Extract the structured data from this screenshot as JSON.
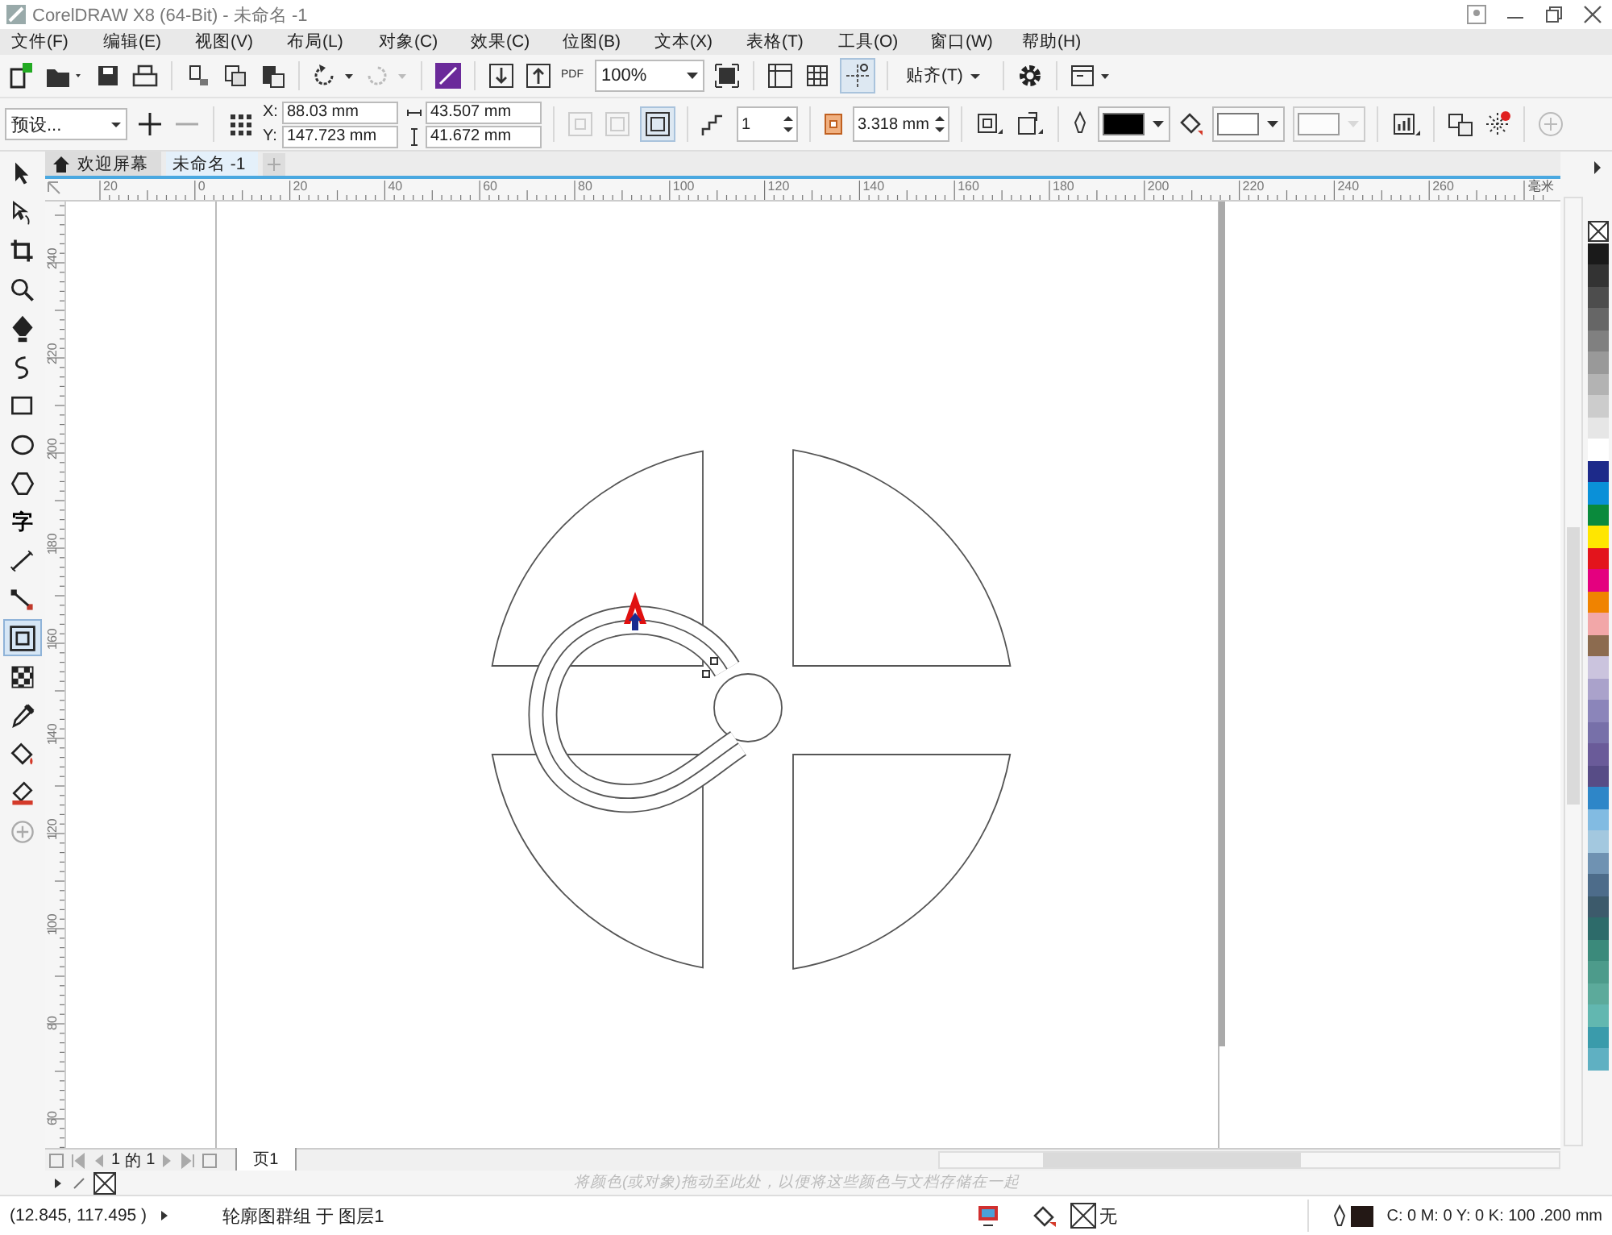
{
  "window": {
    "title": "CorelDRAW X8 (64-Bit) - 未命名 -1"
  },
  "menu": [
    "文件(F)",
    "编辑(E)",
    "视图(V)",
    "布局(L)",
    "对象(C)",
    "效果(C)",
    "位图(B)",
    "文本(X)",
    "表格(T)",
    "工具(O)",
    "窗口(W)",
    "帮助(H)"
  ],
  "toolbar": {
    "pdf_label": "PDF",
    "zoom": "100%",
    "snap": "贴齐(T)"
  },
  "property_bar": {
    "preset": "预设...",
    "x_label": "X:",
    "x_value": "88.03 mm",
    "y_label": "Y:",
    "y_value": "147.723 mm",
    "width": "43.507 mm",
    "height": "41.672 mm",
    "steps": "1",
    "offset": "3.318 mm"
  },
  "doc_tabs": [
    {
      "kind": "home",
      "label": "欢迎屏幕",
      "selected": false
    },
    {
      "kind": "doc",
      "label": "未命名 -1",
      "selected": true
    }
  ],
  "ruler": {
    "x_labels": [
      "20",
      "0",
      "20",
      "40",
      "60",
      "80",
      "100",
      "120",
      "140",
      "160",
      "180",
      "200",
      "220",
      "240",
      "260"
    ],
    "unit": "毫米",
    "y_labels": [
      "240",
      "220",
      "200",
      "180",
      "160",
      "140",
      "120",
      "100",
      "80",
      "60"
    ]
  },
  "tools": [
    {
      "kind": "pick",
      "selected": false
    },
    {
      "kind": "shape",
      "selected": false
    },
    {
      "kind": "crop",
      "selected": false
    },
    {
      "kind": "zoom",
      "selected": false
    },
    {
      "kind": "freehand",
      "selected": false
    },
    {
      "kind": "artistic",
      "selected": false
    },
    {
      "kind": "rectangle",
      "selected": false
    },
    {
      "kind": "ellipse",
      "selected": false
    },
    {
      "kind": "polygon",
      "selected": false
    },
    {
      "kind": "text",
      "label": "字",
      "selected": false
    },
    {
      "kind": "dimension",
      "selected": false
    },
    {
      "kind": "connector",
      "selected": false
    },
    {
      "kind": "contour",
      "selected": true
    },
    {
      "kind": "transparency",
      "selected": false
    },
    {
      "kind": "eyedropper",
      "selected": false
    },
    {
      "kind": "fill",
      "selected": false
    },
    {
      "kind": "smartfill",
      "selected": false
    },
    {
      "kind": "add",
      "selected": false
    }
  ],
  "page_nav": {
    "current": "1",
    "of_label": "的",
    "total": "1",
    "page_tab": "页1"
  },
  "palette_hint": "将颜色(或对象)拖动至此处，以便将这些颜色与文档存储在一起",
  "palette": [
    {
      "kind": "none"
    },
    {
      "kind": "swatch",
      "color": "#1a1a1a"
    },
    {
      "kind": "swatch",
      "color": "#333333"
    },
    {
      "kind": "swatch",
      "color": "#4d4d4d"
    },
    {
      "kind": "swatch",
      "color": "#666666"
    },
    {
      "kind": "swatch",
      "color": "#808080"
    },
    {
      "kind": "swatch",
      "color": "#999999"
    },
    {
      "kind": "swatch",
      "color": "#b3b3b3"
    },
    {
      "kind": "swatch",
      "color": "#cccccc"
    },
    {
      "kind": "swatch",
      "color": "#e6e6e6"
    },
    {
      "kind": "swatch",
      "color": "#ffffff"
    },
    {
      "kind": "swatch",
      "color": "#1d2a8a"
    },
    {
      "kind": "swatch",
      "color": "#0a90d8"
    },
    {
      "kind": "swatch",
      "color": "#0a8a3c"
    },
    {
      "kind": "swatch",
      "color": "#ffe600"
    },
    {
      "kind": "swatch",
      "color": "#e3141c"
    },
    {
      "kind": "swatch",
      "color": "#e4007f"
    },
    {
      "kind": "swatch",
      "color": "#f08300"
    },
    {
      "kind": "swatch",
      "color": "#f2a7a8"
    },
    {
      "kind": "swatch",
      "color": "#8c6b4f"
    },
    {
      "kind": "swatch",
      "color": "#cbc4de"
    },
    {
      "kind": "swatch",
      "color": "#aaa2cb"
    },
    {
      "kind": "swatch",
      "color": "#8b85ba"
    },
    {
      "kind": "swatch",
      "color": "#7770a9"
    },
    {
      "kind": "swatch",
      "color": "#6a5b99"
    },
    {
      "kind": "swatch",
      "color": "#574c86"
    },
    {
      "kind": "swatch",
      "color": "#2e86c8"
    },
    {
      "kind": "swatch",
      "color": "#82bbe2"
    },
    {
      "kind": "swatch",
      "color": "#a3c8df"
    },
    {
      "kind": "swatch",
      "color": "#6f92b2"
    },
    {
      "kind": "swatch",
      "color": "#4d6c8a"
    },
    {
      "kind": "swatch",
      "color": "#3c5a6b"
    },
    {
      "kind": "swatch",
      "color": "#2d6b6a"
    },
    {
      "kind": "swatch",
      "color": "#3b8a7b"
    },
    {
      "kind": "swatch",
      "color": "#4d9b8b"
    },
    {
      "kind": "swatch",
      "color": "#5caa9b"
    },
    {
      "kind": "swatch",
      "color": "#62b7b0"
    },
    {
      "kind": "swatch",
      "color": "#3a9bab"
    },
    {
      "kind": "swatch",
      "color": "#5fb0c2"
    }
  ],
  "status_bar": {
    "coordinates": "(12.845, 117.495 )",
    "object_info": "轮廓图群组 于 图层1",
    "fill_label": "无",
    "outline_info": "C: 0 M: 0 Y: 0 K: 100  .200 mm"
  }
}
